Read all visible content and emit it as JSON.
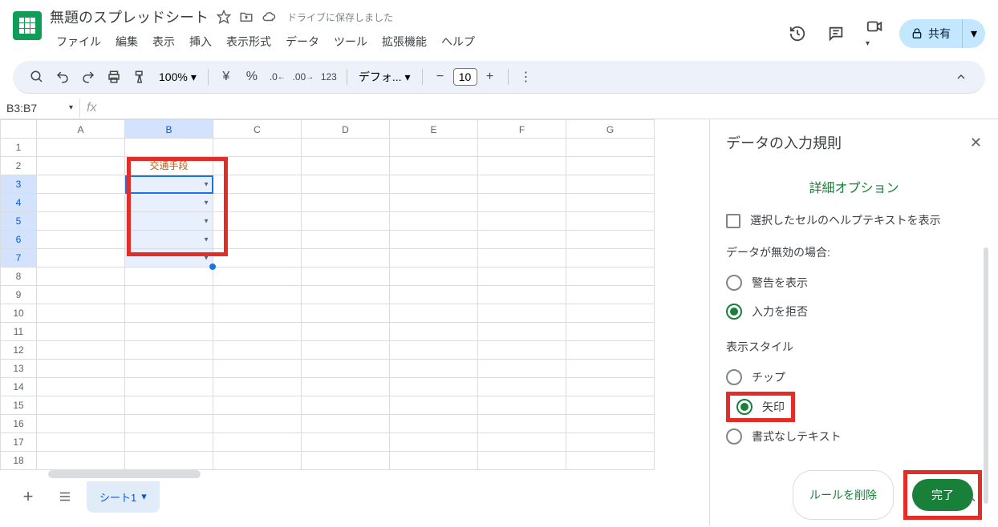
{
  "header": {
    "doc_title": "無題のスプレッドシート",
    "saved_text": "ドライブに保存しました",
    "share_label": "共有"
  },
  "menu": [
    "ファイル",
    "編集",
    "表示",
    "挿入",
    "表示形式",
    "データ",
    "ツール",
    "拡張機能",
    "ヘルプ"
  ],
  "toolbar": {
    "zoom": "100%",
    "font": "デフォ...",
    "fontsize": "10"
  },
  "namebox": "B3:B7",
  "columns": [
    "A",
    "B",
    "C",
    "D",
    "E",
    "F",
    "G"
  ],
  "rows_count": 18,
  "selected_rows": [
    3,
    4,
    5,
    6,
    7
  ],
  "selected_col_index": 1,
  "b2_value": "交通手段",
  "sidepanel": {
    "title": "データの入力規則",
    "advanced": "詳細オプション",
    "help_checkbox": "選択したセルのヘルプテキストを表示",
    "invalid_label": "データが無効の場合:",
    "invalid_options": [
      "警告を表示",
      "入力を拒否"
    ],
    "invalid_selected": 1,
    "style_label": "表示スタイル",
    "style_options": [
      "チップ",
      "矢印",
      "書式なしテキスト"
    ],
    "style_selected": 1,
    "delete_btn": "ルールを削除",
    "done_btn": "完了"
  },
  "bottom": {
    "sheet_name": "シート1"
  }
}
